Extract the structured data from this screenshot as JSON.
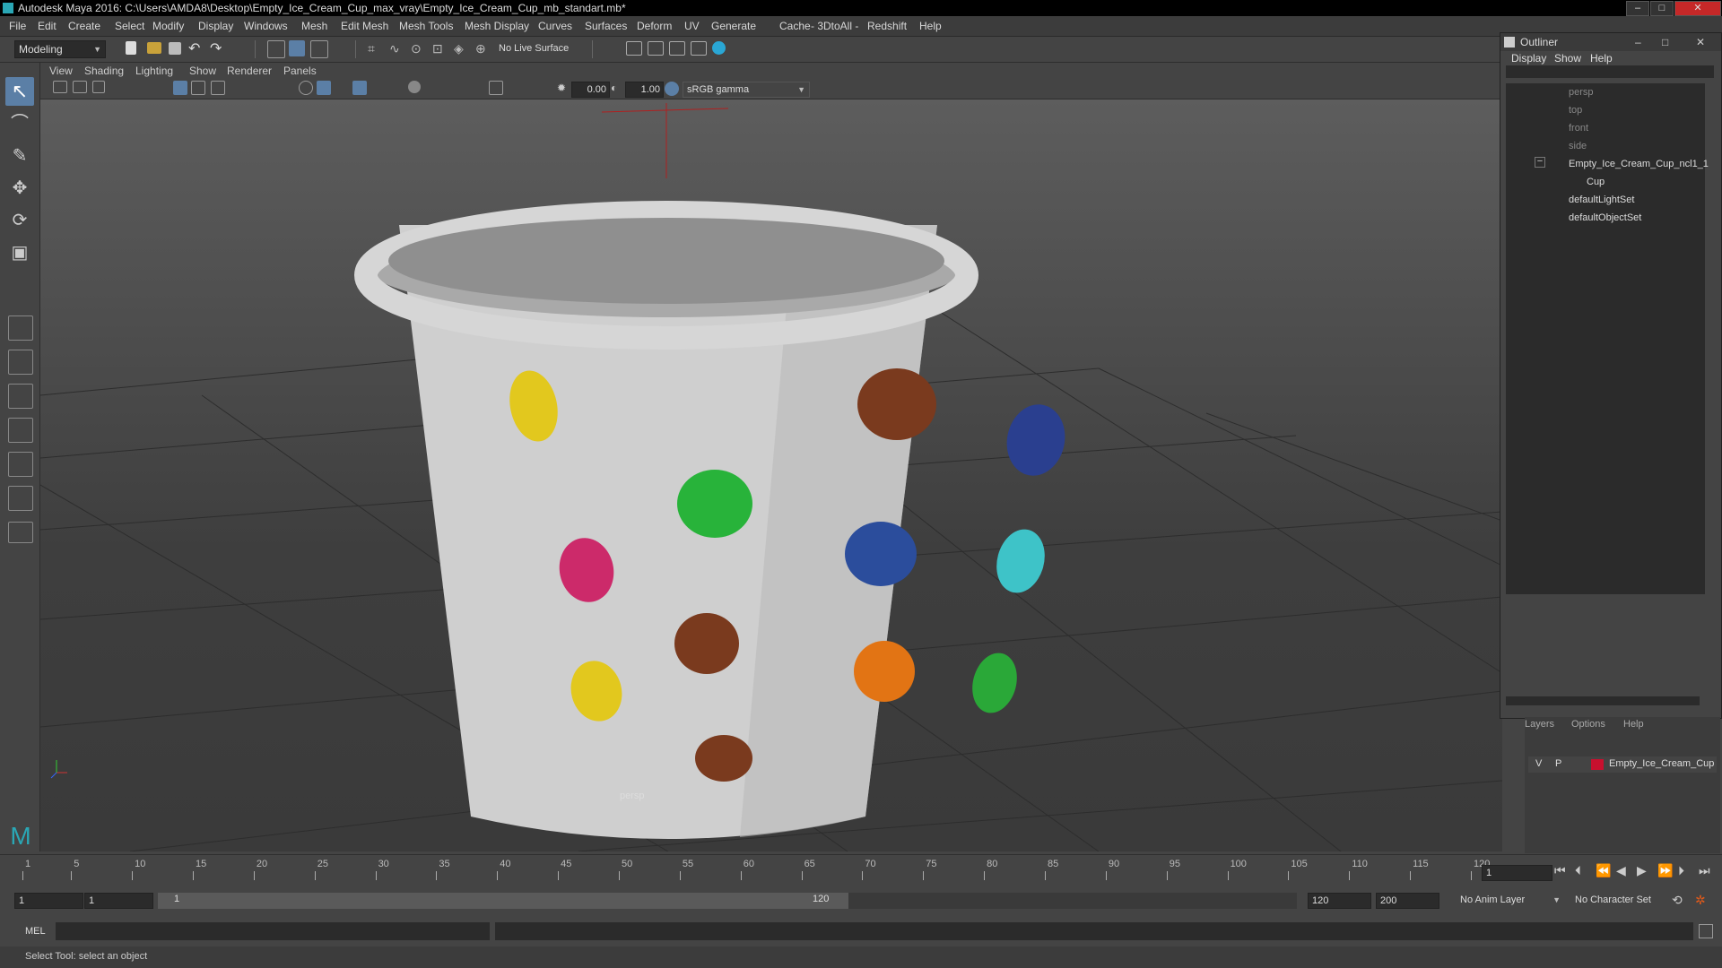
{
  "window": {
    "title": "Autodesk Maya 2016: C:\\Users\\AMDA8\\Desktop\\Empty_Ice_Cream_Cup_max_vray\\Empty_Ice_Cream_Cup_mb_standart.mb*",
    "minimize": "–",
    "maximize": "□",
    "close": "✕"
  },
  "menubar": [
    "File",
    "Edit",
    "Create",
    "Select",
    "Modify",
    "Display",
    "Windows",
    "Mesh",
    "Edit Mesh",
    "Mesh Tools",
    "Mesh Display",
    "Curves",
    "Surfaces",
    "Deform",
    "UV",
    "Generate",
    "Cache",
    "- 3DtoAll -",
    "Redshift",
    "Help"
  ],
  "statusline": {
    "menuset": "Modeling",
    "live_surface": "No Live Surface"
  },
  "panel": {
    "menus": [
      "View",
      "Shading",
      "Lighting",
      "Show",
      "Renderer",
      "Panels"
    ],
    "exposure": "0.00",
    "gamma": "1.00",
    "colorspace": "sRGB gamma",
    "camera_label": "persp"
  },
  "outliner": {
    "title": "Outliner",
    "menus": [
      "Display",
      "Show",
      "Help"
    ],
    "items": [
      {
        "label": "persp",
        "dim": true
      },
      {
        "label": "top",
        "dim": true
      },
      {
        "label": "front",
        "dim": true
      },
      {
        "label": "side",
        "dim": true
      },
      {
        "label": "Empty_Ice_Cream_Cup_ncl1_1",
        "dim": false
      },
      {
        "label": "Cup",
        "dim": false
      },
      {
        "label": "defaultLightSet",
        "dim": false
      },
      {
        "label": "defaultObjectSet",
        "dim": false
      }
    ],
    "collapse": "−"
  },
  "layers": {
    "menus": [
      "Layers",
      "Options",
      "Help"
    ],
    "row": {
      "v": "V",
      "p": "P",
      "name": "Empty_Ice_Cream_Cup",
      "color": "#c8102e"
    }
  },
  "timeline": {
    "ticks": [
      "1",
      "5",
      "10",
      "15",
      "20",
      "25",
      "30",
      "35",
      "40",
      "45",
      "50",
      "55",
      "60",
      "65",
      "70",
      "75",
      "80",
      "85",
      "90",
      "95",
      "100",
      "105",
      "110",
      "115",
      "120"
    ],
    "current_frame": "1"
  },
  "range": {
    "start": "1",
    "playback_start": "1",
    "slider_start": "1",
    "slider_end": "120",
    "playback_end": "120",
    "end": "200",
    "anim_layer": "No Anim Layer",
    "character_set": "No Character Set"
  },
  "cmdline": {
    "label": "MEL"
  },
  "helpline": {
    "text": "Select Tool: select an object"
  },
  "cup": {
    "dot_colors": [
      "#e2c81e",
      "#7a3a1e",
      "#2a3f8f",
      "#28b33a",
      "#cc2a6a",
      "#2b4d9c",
      "#3ec3c8",
      "#7a3a1e",
      "#e27414",
      "#2aa838"
    ]
  }
}
